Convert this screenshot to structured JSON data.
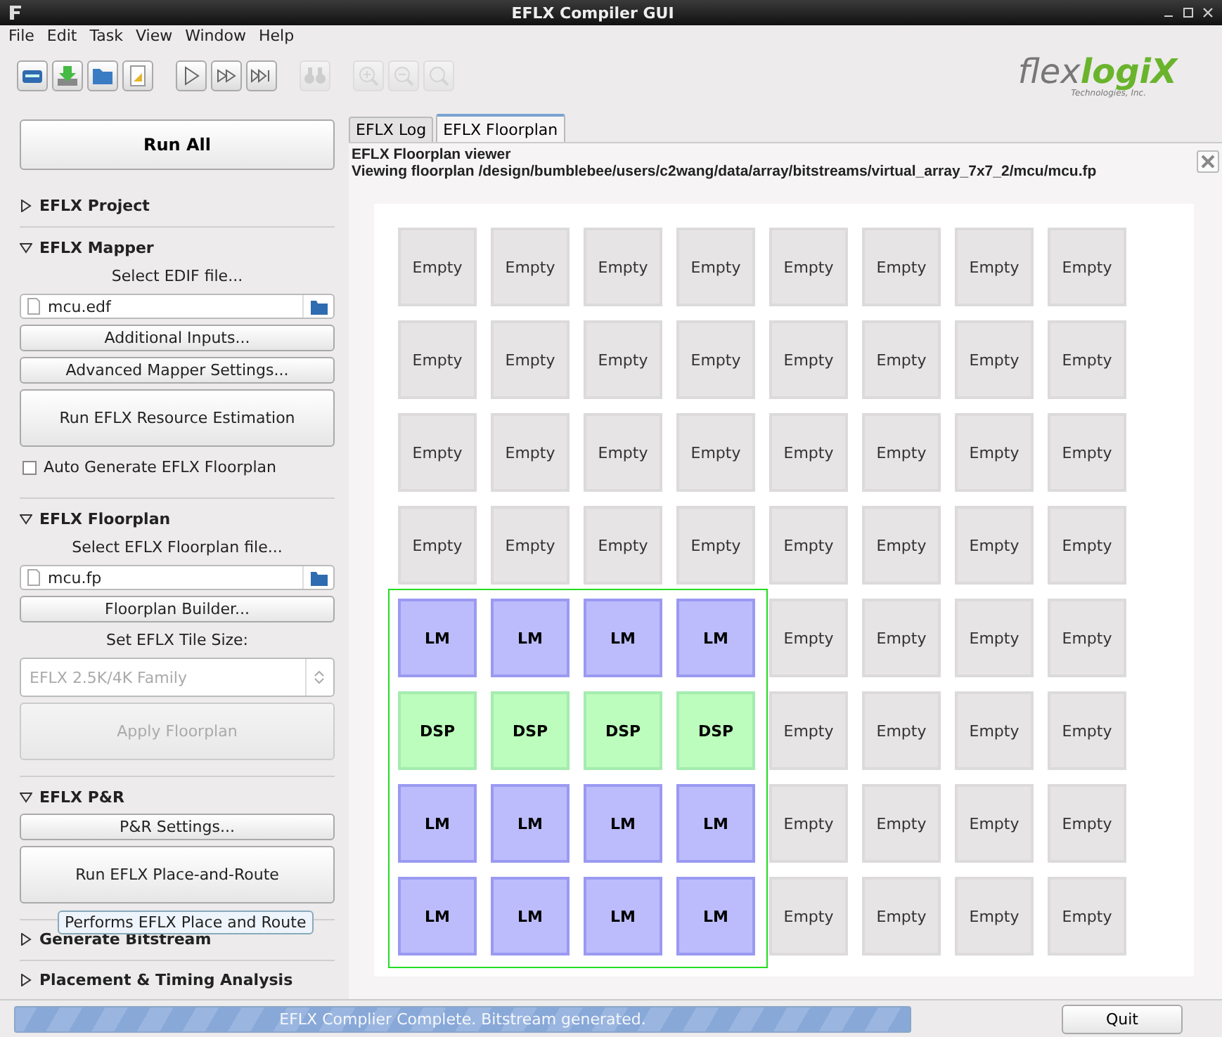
{
  "window": {
    "title": "EFLX Compiler GUI"
  },
  "menu": [
    "File",
    "Edit",
    "Task",
    "View",
    "Window",
    "Help"
  ],
  "toolbar": [
    {
      "kind": "drive",
      "disabled": false
    },
    {
      "kind": "download",
      "disabled": false
    },
    {
      "kind": "folder",
      "disabled": false
    },
    {
      "kind": "document",
      "disabled": false
    },
    {
      "kind": "play",
      "disabled": false
    },
    {
      "kind": "step",
      "disabled": false
    },
    {
      "kind": "run-end",
      "disabled": false
    },
    {
      "kind": "binoculars",
      "disabled": true
    },
    {
      "kind": "zoom-in",
      "disabled": true
    },
    {
      "kind": "zoom-out",
      "disabled": true
    },
    {
      "kind": "zoom-fit",
      "disabled": true
    }
  ],
  "logo": {
    "name": "flex",
    "accent": "logiX",
    "tagline": "Technologies, Inc."
  },
  "sidebar": {
    "run_all": "Run All",
    "sections": [
      {
        "title": "EFLX Project",
        "expanded": false
      },
      {
        "title": "EFLX Mapper",
        "expanded": true,
        "items": [
          {
            "kind": "label",
            "text": "Select EDIF file..."
          },
          {
            "kind": "file",
            "text": "mcu.edf"
          },
          {
            "kind": "button",
            "text": "Additional Inputs...",
            "disabled": false
          },
          {
            "kind": "button",
            "text": "Advanced Mapper Settings...",
            "disabled": false
          },
          {
            "kind": "tall-button",
            "text": "Run EFLX Resource Estimation",
            "disabled": false
          },
          {
            "kind": "checkbox",
            "text": "Auto Generate EFLX Floorplan",
            "checked": false
          }
        ]
      },
      {
        "title": "EFLX Floorplan",
        "expanded": true,
        "items": [
          {
            "kind": "label",
            "text": "Select EFLX Floorplan file..."
          },
          {
            "kind": "file",
            "text": "mcu.fp"
          },
          {
            "kind": "button",
            "text": "Floorplan Builder...",
            "disabled": false
          },
          {
            "kind": "label",
            "text": "Set EFLX Tile Size:"
          },
          {
            "kind": "select",
            "text": "EFLX 2.5K/4K Family",
            "disabled": true
          },
          {
            "kind": "tall-button",
            "text": "Apply Floorplan",
            "disabled": true
          }
        ]
      },
      {
        "title": "EFLX P&R",
        "expanded": true,
        "items": [
          {
            "kind": "button",
            "text": "P&R Settings...",
            "disabled": false
          },
          {
            "kind": "tall-button",
            "text": "Run EFLX Place-and-Route",
            "disabled": false
          }
        ]
      },
      {
        "title": "Generate Bitstream",
        "expanded": false
      },
      {
        "title": "Placement & Timing Analysis",
        "expanded": false
      }
    ]
  },
  "tooltip": "Performs EFLX Place and Route",
  "tabs": [
    {
      "label": "EFLX Log",
      "selected": false
    },
    {
      "label": "EFLX Floorplan",
      "selected": true
    }
  ],
  "viewer": {
    "title": "EFLX Floorplan viewer",
    "path": "Viewing floorplan /design/bumblebee/users/c2wang/data/array/bitstreams/virtual_array_7x7_2/mcu/mcu.fp"
  },
  "floorplan": {
    "rows": [
      {
        "tiles": [
          {
            "kind": "empty",
            "label": "Empty"
          },
          {
            "kind": "empty",
            "label": "Empty"
          },
          {
            "kind": "empty",
            "label": "Empty"
          },
          {
            "kind": "empty",
            "label": "Empty"
          },
          {
            "kind": "empty",
            "label": "Empty"
          },
          {
            "kind": "empty",
            "label": "Empty"
          },
          {
            "kind": "empty",
            "label": "Empty"
          },
          {
            "kind": "empty",
            "label": "Empty"
          }
        ]
      },
      {
        "tiles": [
          {
            "kind": "empty",
            "label": "Empty"
          },
          {
            "kind": "empty",
            "label": "Empty"
          },
          {
            "kind": "empty",
            "label": "Empty"
          },
          {
            "kind": "empty",
            "label": "Empty"
          },
          {
            "kind": "empty",
            "label": "Empty"
          },
          {
            "kind": "empty",
            "label": "Empty"
          },
          {
            "kind": "empty",
            "label": "Empty"
          },
          {
            "kind": "empty",
            "label": "Empty"
          }
        ]
      },
      {
        "tiles": [
          {
            "kind": "empty",
            "label": "Empty"
          },
          {
            "kind": "empty",
            "label": "Empty"
          },
          {
            "kind": "empty",
            "label": "Empty"
          },
          {
            "kind": "empty",
            "label": "Empty"
          },
          {
            "kind": "empty",
            "label": "Empty"
          },
          {
            "kind": "empty",
            "label": "Empty"
          },
          {
            "kind": "empty",
            "label": "Empty"
          },
          {
            "kind": "empty",
            "label": "Empty"
          }
        ]
      },
      {
        "tiles": [
          {
            "kind": "empty",
            "label": "Empty"
          },
          {
            "kind": "empty",
            "label": "Empty"
          },
          {
            "kind": "empty",
            "label": "Empty"
          },
          {
            "kind": "empty",
            "label": "Empty"
          },
          {
            "kind": "empty",
            "label": "Empty"
          },
          {
            "kind": "empty",
            "label": "Empty"
          },
          {
            "kind": "empty",
            "label": "Empty"
          },
          {
            "kind": "empty",
            "label": "Empty"
          }
        ]
      },
      {
        "region_tiles": [
          {
            "kind": "lm",
            "label": "LM"
          },
          {
            "kind": "lm",
            "label": "LM"
          },
          {
            "kind": "lm",
            "label": "LM"
          },
          {
            "kind": "lm",
            "label": "LM"
          }
        ],
        "tiles": [
          {
            "kind": "empty",
            "label": "Empty"
          },
          {
            "kind": "empty",
            "label": "Empty"
          },
          {
            "kind": "empty",
            "label": "Empty"
          },
          {
            "kind": "empty",
            "label": "Empty"
          }
        ]
      },
      {
        "region_tiles": [
          {
            "kind": "dsp",
            "label": "DSP"
          },
          {
            "kind": "dsp",
            "label": "DSP"
          },
          {
            "kind": "dsp",
            "label": "DSP"
          },
          {
            "kind": "dsp",
            "label": "DSP"
          }
        ],
        "tiles": [
          {
            "kind": "empty",
            "label": "Empty"
          },
          {
            "kind": "empty",
            "label": "Empty"
          },
          {
            "kind": "empty",
            "label": "Empty"
          },
          {
            "kind": "empty",
            "label": "Empty"
          }
        ]
      },
      {
        "region_tiles": [
          {
            "kind": "lm",
            "label": "LM"
          },
          {
            "kind": "lm",
            "label": "LM"
          },
          {
            "kind": "lm",
            "label": "LM"
          },
          {
            "kind": "lm",
            "label": "LM"
          }
        ],
        "tiles": [
          {
            "kind": "empty",
            "label": "Empty"
          },
          {
            "kind": "empty",
            "label": "Empty"
          },
          {
            "kind": "empty",
            "label": "Empty"
          },
          {
            "kind": "empty",
            "label": "Empty"
          }
        ]
      },
      {
        "region_tiles": [
          {
            "kind": "lm",
            "label": "LM"
          },
          {
            "kind": "lm",
            "label": "LM"
          },
          {
            "kind": "lm",
            "label": "LM"
          },
          {
            "kind": "lm",
            "label": "LM"
          }
        ],
        "tiles": [
          {
            "kind": "empty",
            "label": "Empty"
          },
          {
            "kind": "empty",
            "label": "Empty"
          },
          {
            "kind": "empty",
            "label": "Empty"
          },
          {
            "kind": "empty",
            "label": "Empty"
          }
        ]
      }
    ]
  },
  "status": {
    "text": "EFLX Complier Complete. Bitstream generated.",
    "level": 1
  },
  "quit": "Quit"
}
